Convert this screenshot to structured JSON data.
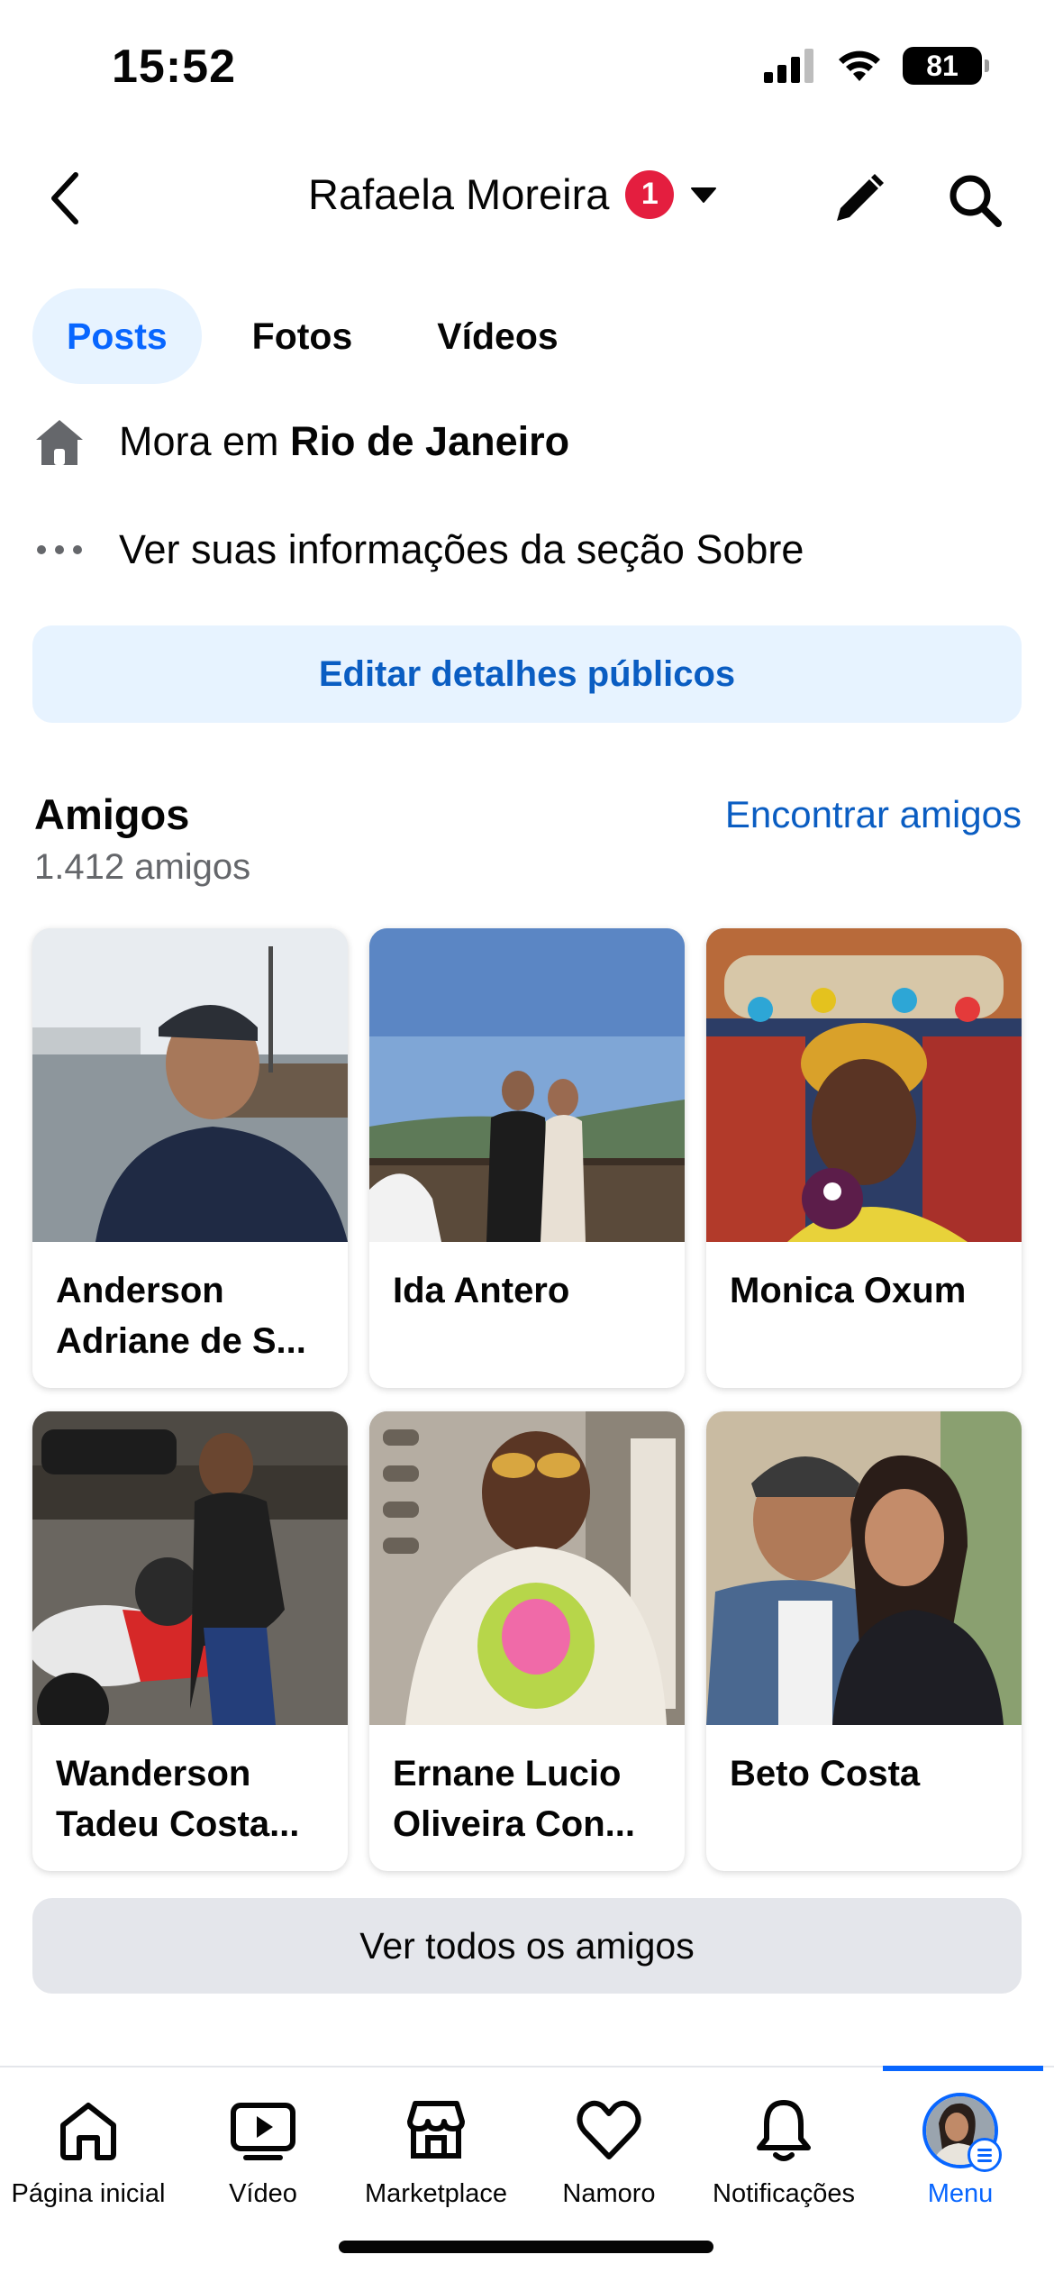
{
  "status_bar": {
    "time": "15:52",
    "battery": "81"
  },
  "header": {
    "title": "Rafaela Moreira",
    "notification_count": "1"
  },
  "tabs": [
    {
      "label": "Posts",
      "active": true
    },
    {
      "label": "Fotos",
      "active": false
    },
    {
      "label": "Vídeos",
      "active": false
    }
  ],
  "info": {
    "lives_in_prefix": "Mora em ",
    "lives_in_city": "Rio de Janeiro",
    "about_text": "Ver suas informações da seção Sobre"
  },
  "edit_details_label": "Editar detalhes públicos",
  "friends": {
    "title": "Amigos",
    "count": "1.412 amigos",
    "find_label": "Encontrar amigos",
    "cards": [
      {
        "line1": "Anderson",
        "line2": "Adriane de S..."
      },
      {
        "line1": "Ida Antero",
        "line2": ""
      },
      {
        "line1": "Monica Oxum",
        "line2": ""
      },
      {
        "line1": "Wanderson",
        "line2": "Tadeu Costa..."
      },
      {
        "line1": "Ernane Lucio",
        "line2": "Oliveira Con..."
      },
      {
        "line1": "Beto Costa",
        "line2": ""
      }
    ],
    "see_all_label": "Ver todos os amigos"
  },
  "bottom_nav": [
    {
      "label": "Página inicial",
      "icon": "home-icon"
    },
    {
      "label": "Vídeo",
      "icon": "video-icon"
    },
    {
      "label": "Marketplace",
      "icon": "marketplace-icon"
    },
    {
      "label": "Namoro",
      "icon": "heart-icon"
    },
    {
      "label": "Notificações",
      "icon": "bell-icon"
    },
    {
      "label": "Menu",
      "icon": "avatar-menu-icon",
      "active": true
    }
  ],
  "colors": {
    "accent": "#0866ff",
    "badge": "#e41e3f",
    "link": "#0a5dc2",
    "tab_active_bg": "#e7f3ff"
  }
}
